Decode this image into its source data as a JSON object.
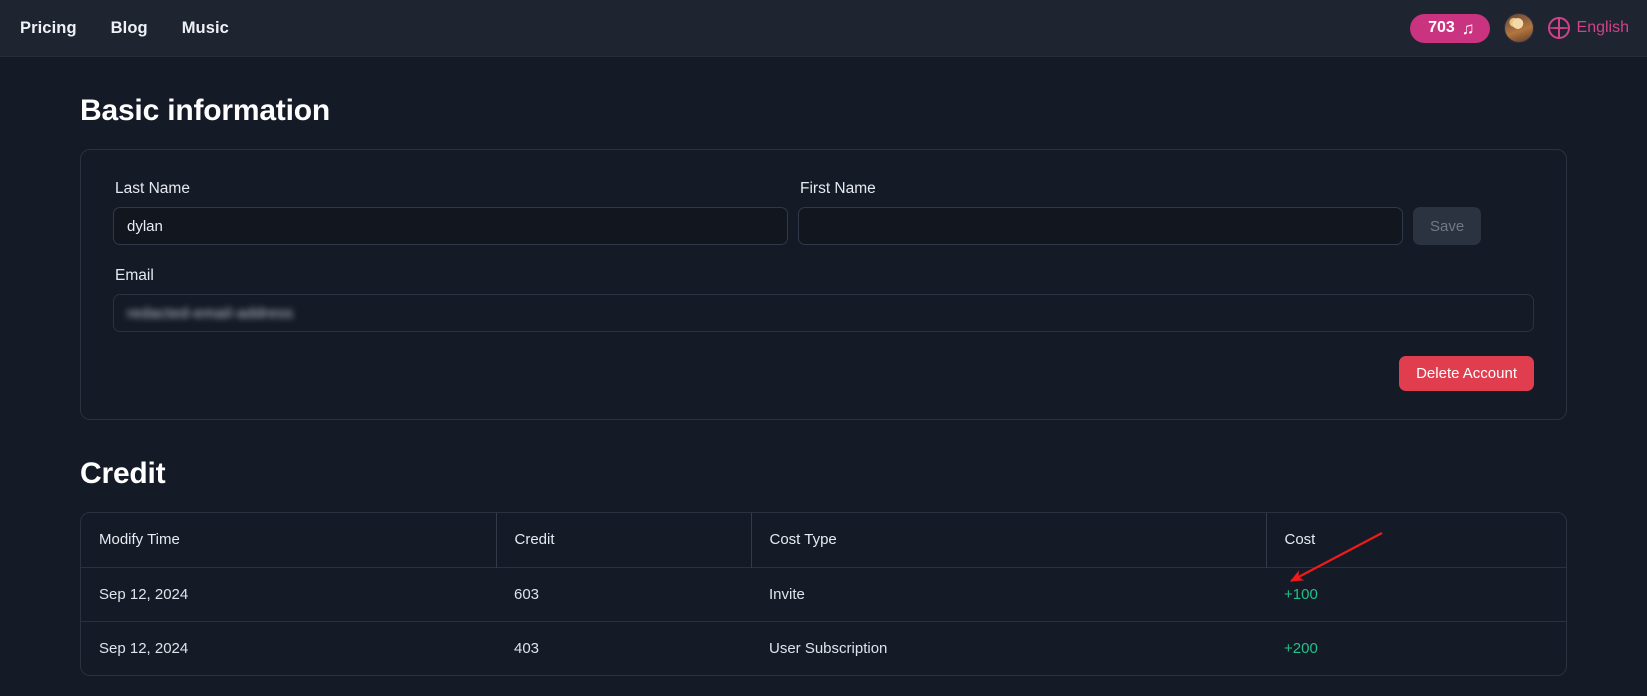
{
  "navbar": {
    "links": [
      {
        "label": "Pricing"
      },
      {
        "label": "Blog"
      },
      {
        "label": "Music"
      }
    ],
    "credit_badge": {
      "value": "703",
      "icon": "music-note-icon"
    },
    "avatar_alt": "user-avatar",
    "language": {
      "label": "English",
      "icon": "globe-icon"
    }
  },
  "basic_information": {
    "title": "Basic information",
    "last_name": {
      "label": "Last Name",
      "value": "dylan",
      "placeholder": ""
    },
    "first_name": {
      "label": "First Name",
      "value": "",
      "placeholder": ""
    },
    "email": {
      "label": "Email",
      "value": "redacted-email-address",
      "redacted": true
    },
    "save_label": "Save",
    "delete_label": "Delete Account"
  },
  "credit": {
    "title": "Credit",
    "columns": [
      "Modify Time",
      "Credit",
      "Cost Type",
      "Cost"
    ],
    "rows": [
      {
        "modify_time": "Sep 12, 2024",
        "credit": "603",
        "cost_type": "Invite",
        "cost": "+100"
      },
      {
        "modify_time": "Sep 12, 2024",
        "credit": "403",
        "cost_type": "User Subscription",
        "cost": "+200"
      }
    ]
  },
  "annotation": {
    "arrow_color": "#f01a1a",
    "points_to": "+100"
  },
  "colors": {
    "page_bg": "#141a26",
    "nav_bg": "#1f2431",
    "accent_pink": "#c9337f",
    "lang_pink": "#d1418c",
    "danger_red": "#e03d4e",
    "positive_green": "#22c08a"
  }
}
